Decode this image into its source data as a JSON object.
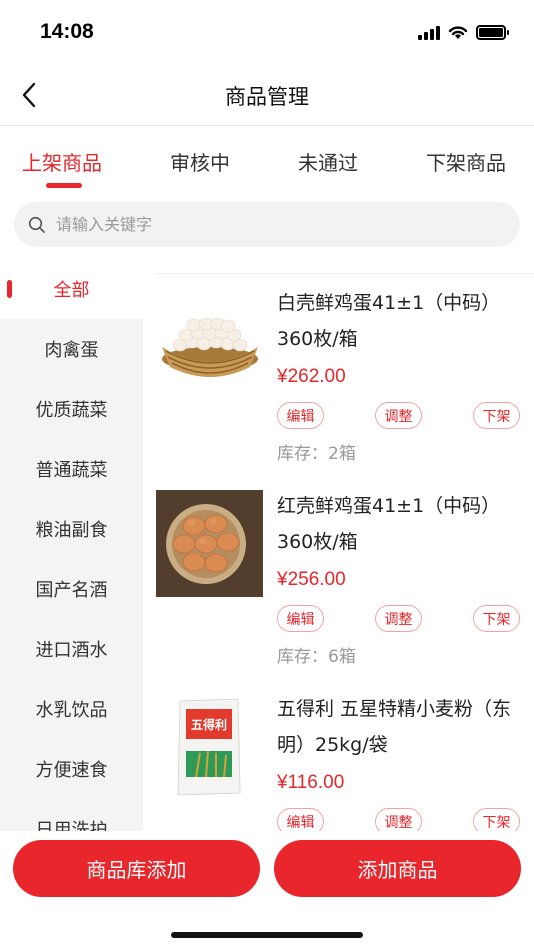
{
  "status_bar": {
    "time": "14:08",
    "signal_icon": "signal-icon",
    "wifi_icon": "wifi-icon",
    "battery_icon": "battery-icon"
  },
  "nav": {
    "title": "商品管理",
    "back_icon": "back-arrow-icon"
  },
  "tabs": [
    {
      "label": "上架商品",
      "active": true
    },
    {
      "label": "审核中",
      "active": false
    },
    {
      "label": "未通过",
      "active": false
    },
    {
      "label": "下架商品",
      "active": false
    }
  ],
  "search": {
    "placeholder": "请输入关键字",
    "value": "",
    "icon": "search-icon"
  },
  "sidebar": {
    "items": [
      {
        "label": "全部",
        "active": true
      },
      {
        "label": "肉禽蛋"
      },
      {
        "label": "优质蔬菜"
      },
      {
        "label": "普通蔬菜"
      },
      {
        "label": "粮油副食"
      },
      {
        "label": "国产名酒"
      },
      {
        "label": "进口酒水"
      },
      {
        "label": "水乳饮品"
      },
      {
        "label": "方便速食"
      },
      {
        "label": "日用洗护"
      }
    ]
  },
  "products": [
    {
      "name": "白壳鲜鸡蛋41±1（中码）360枚/箱",
      "price": "¥262.00",
      "edit": "编辑",
      "adjust": "调整",
      "delist": "下架",
      "stock": "库存：2箱",
      "image": "white-eggs-basket"
    },
    {
      "name": "红壳鲜鸡蛋41±1（中码）360枚/箱",
      "price": "¥256.00",
      "edit": "编辑",
      "adjust": "调整",
      "delist": "下架",
      "stock": "库存：6箱",
      "image": "brown-eggs-bowl"
    },
    {
      "name": "五得利 五星特精小麦粉（东明）25kg/袋",
      "price": "¥116.00",
      "edit": "编辑",
      "adjust": "调整",
      "delist": "下架",
      "stock": "",
      "image": "flour-bag",
      "flour_brand": "五得利"
    }
  ],
  "bottom": {
    "library_add": "商品库添加",
    "add_product": "添加商品"
  },
  "colors": {
    "accent": "#e8262b",
    "sidebar_bg": "#f4f4f5",
    "muted_text": "#999999"
  }
}
